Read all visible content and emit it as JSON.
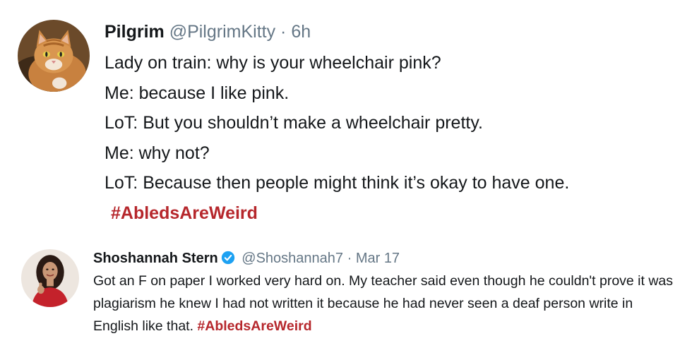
{
  "tweets": [
    {
      "name": "Pilgrim",
      "handle": "@PilgrimKitty",
      "separator": "·",
      "time": "6h",
      "verified": false,
      "avatar": "orange-cat-avatar",
      "lines": [
        "Lady on train: why is your wheelchair pink?",
        "Me: because I like pink.",
        "LoT: But you shouldn’t make a wheelchair pretty.",
        "Me: why not?",
        "LoT: Because then people might think it’s okay to have one."
      ],
      "hashtag": "#AbledsAreWeird"
    },
    {
      "name": "Shoshannah Stern",
      "handle": "@Shoshannah7",
      "separator": "·",
      "time": "Mar 17",
      "verified": true,
      "avatar": "woman-in-red-dress-avatar",
      "text": "Got an F on paper I worked very hard on. My teacher said even though he couldn't prove it was plagiarism he knew I had not written it because he had never seen a deaf person write in English like that.",
      "hashtag": "#AbledsAreWeird"
    }
  ],
  "colors": {
    "hashtag": "#b6272c",
    "muted": "#657786",
    "text": "#14171a",
    "verified": "#1da1f2"
  }
}
